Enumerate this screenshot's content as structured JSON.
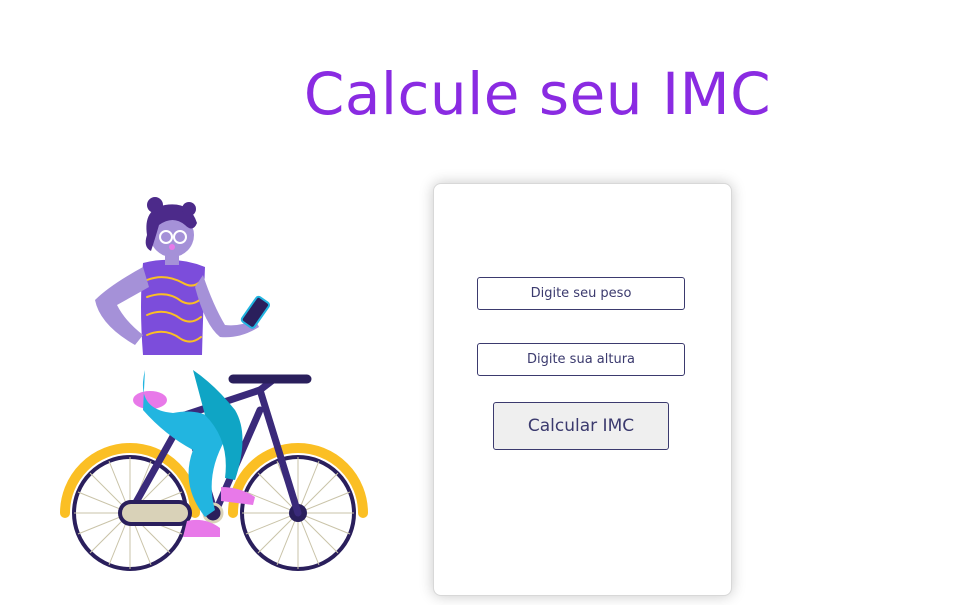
{
  "page": {
    "title": "Calcule seu IMC"
  },
  "form": {
    "weight_placeholder": "Digite seu peso",
    "height_placeholder": "Digite sua altura",
    "submit_label": "Calcular IMC"
  },
  "illustration": {
    "name": "woman-on-bicycle-illustration"
  },
  "colors": {
    "title": "#8a2be2",
    "form_border": "#3b3a6e",
    "button_bg": "#efefef"
  }
}
